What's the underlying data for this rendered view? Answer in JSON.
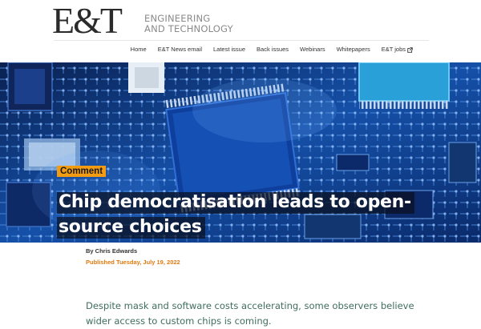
{
  "brand": {
    "logo": "E&T",
    "tagline_line1": "ENGINEERING",
    "tagline_line2": "AND TECHNOLOGY"
  },
  "nav": {
    "items": [
      {
        "label": "Home"
      },
      {
        "label": "E&T News email"
      },
      {
        "label": "Latest issue"
      },
      {
        "label": "Back issues"
      },
      {
        "label": "Webinars"
      },
      {
        "label": "Whitepapers"
      },
      {
        "label": "E&T jobs",
        "icon": "external-link-icon"
      }
    ]
  },
  "article": {
    "category": "Comment",
    "title": "Chip democratisation leads to open-source choices",
    "byline": "By Chris Edwards",
    "published_label": "Published",
    "published_date": "Tuesday, July 19, 2022",
    "standfirst": "Despite mask and software costs accelerating, some observers believe wider access to custom chips is coming."
  },
  "colors": {
    "accent": "#f39c12",
    "standfirst": "#3f6e5e",
    "hero_base": "#0d2c66"
  }
}
